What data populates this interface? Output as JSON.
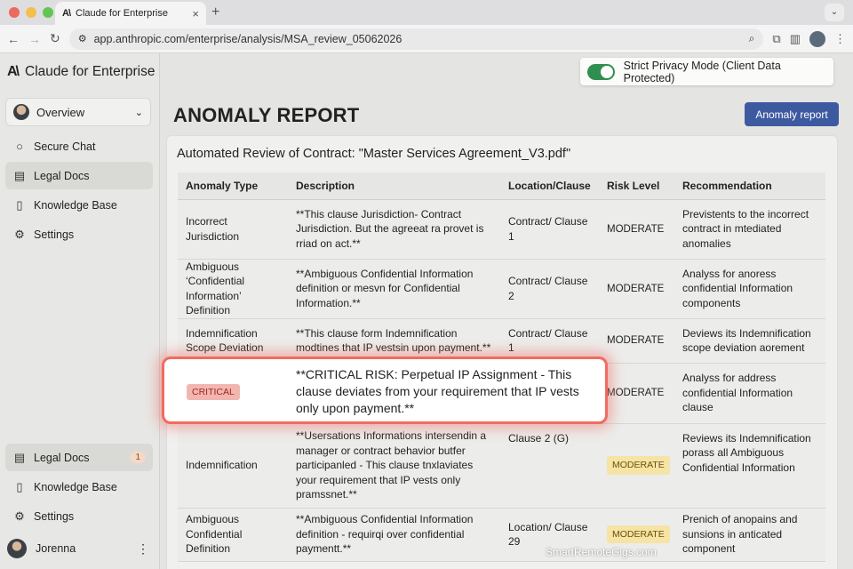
{
  "browser": {
    "tab_title": "Claude for Enterprise",
    "tab_close": "×",
    "new_tab": "+",
    "url": "app.anthropic.com/enterprise/analysis/MSA_review_05062026",
    "dots": [
      "#ec6a5e",
      "#f4bf4f",
      "#61c554"
    ]
  },
  "sidebar": {
    "brand": "Claude for Enterprise",
    "brand_logo": "A\\",
    "workspace": "Overview",
    "nav_top": [
      {
        "label": "Secure Chat",
        "icon": "chat-bubble-icon"
      },
      {
        "label": "Legal Docs",
        "icon": "document-icon",
        "active": true
      },
      {
        "label": "Knowledge Base",
        "icon": "book-icon"
      },
      {
        "label": "Settings",
        "icon": "gear-icon"
      }
    ],
    "nav_bottom": [
      {
        "label": "Legal Docs",
        "icon": "document-icon",
        "badge": "1",
        "active": true
      },
      {
        "label": "Knowledge Base",
        "icon": "book-icon"
      },
      {
        "label": "Settings",
        "icon": "gear-icon"
      }
    ],
    "user": "Jorenna"
  },
  "header": {
    "privacy_label": "Strict Privacy Mode (Client Data Protected)",
    "privacy_on": true,
    "page_title": "ANOMALY REPORT",
    "report_button": "Anomaly report"
  },
  "report": {
    "title": "Automated Review of Contract: \"Master Services Agreement_V3.pdf\"",
    "columns": [
      "Anomaly Type",
      "Description",
      "Location/Clause",
      "Risk Level",
      "Recommendation"
    ],
    "rows": [
      {
        "type": "Incorrect Jurisdiction",
        "desc": "**This clause Jurisdiction- Contract Jurisdiction. But the agreeat ra provet is rriad on act.**",
        "loc": "Contract/ Clause 1",
        "risk": "MODERATE",
        "risk_style": "plain",
        "rec": "Previstents to the incorrect contract in mtediated anomalies"
      },
      {
        "type": "Ambiguous ‘Confidential Information’ Definition",
        "desc": "**Ambiguous Confidential Information definition or mesvn for Confidential Information.**",
        "loc": "Contract/ Clause 2",
        "risk": "MODERATE",
        "risk_style": "plain",
        "rec": "Analyss for anoress confidential Information components"
      },
      {
        "type": "Indemnification Scope Deviation",
        "desc": "**This clause form Indemnification modtines that IP vestsin upon payment.**",
        "loc": "Contract/ Clause 1",
        "risk": "MODERATE",
        "risk_style": "plain",
        "rec": "Deviews its Indemnification scope deviation aorement"
      },
      {
        "type": "",
        "desc": "",
        "loc": "",
        "risk": "MODERATE",
        "risk_style": "plain",
        "rec": "Analyss for address confidential Information clause"
      },
      {
        "type": "Indemnification",
        "desc": "**Usersations Informations intersendin a manager or contract behavior butfer participanled - This clause tnxlaviates your requirement that IP vests only pramssnet.**",
        "loc": "Clause 2 (G)",
        "risk": "MODERATE",
        "risk_style": "chip",
        "rec": "Reviews its Indemnification porass all Ambiguous Confidential Information"
      },
      {
        "type": "Ambiguous Confidential Definition",
        "desc": "**Ambiguous Confidential Information definition - requirqi over confidential paymentt.**",
        "loc": "Location/ Clause 29",
        "risk": "MODERATE",
        "risk_style": "chip",
        "rec": "Prenich of anopains and sunsions in anticated component"
      }
    ],
    "critical": {
      "chip": "CRITICAL",
      "text": "**CRITICAL RISK: Perpetual IP Assignment - This clause deviates from your requirement that IP vests only upon payment.**"
    }
  },
  "watermark": "SmartRemoteGigs.com"
}
